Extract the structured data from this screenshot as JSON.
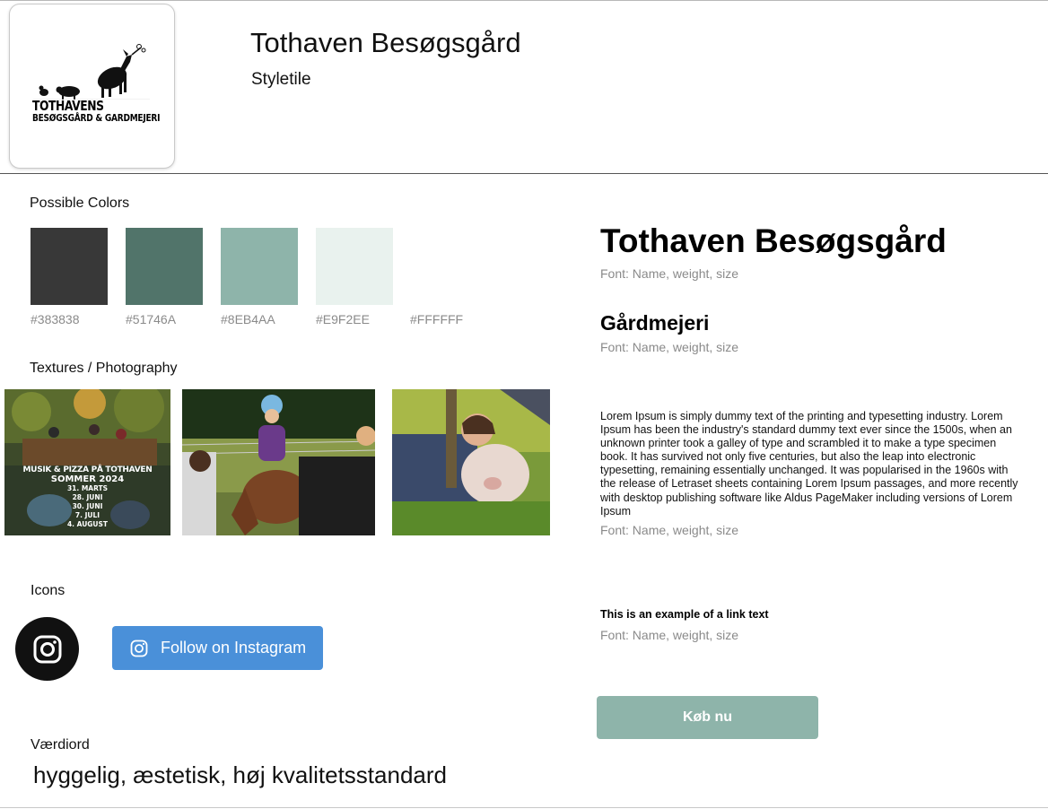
{
  "header": {
    "title": "Tothaven Besøgsgård",
    "subtitle": "Styletile"
  },
  "logo": {
    "line1": "TOTHAVENS",
    "line2": "BESØGSGÅRD & GARDMEJERI"
  },
  "colors": {
    "label": "Possible Colors",
    "swatches": [
      {
        "hex": "#383838",
        "label": "#383838"
      },
      {
        "hex": "#51746A",
        "label": "#51746A"
      },
      {
        "hex": "#8EB4AA",
        "label": "#8EB4AA"
      },
      {
        "hex": "#E9F2EE",
        "label": "#E9F2EE"
      },
      {
        "hex": "#FFFFFF",
        "label": "#FFFFFF"
      }
    ]
  },
  "textures": {
    "label": "Textures / Photography",
    "poster": {
      "title1": "MUSIK & PIZZA PÅ TOTHAVEN",
      "title2": "SOMMER 2024",
      "dates": [
        "31. MARTS",
        "28. JUNI",
        "30. JUNI",
        "7. JULI",
        "4. AUGUST"
      ]
    }
  },
  "icons": {
    "label": "Icons",
    "instagram_circle": "instagram-icon",
    "follow_button": "Follow on Instagram"
  },
  "values": {
    "label": "Værdiord",
    "text": "hyggelig, æstetisk, høj kvalitetsstandard"
  },
  "typography": {
    "h1": "Tothaven Besøgsgård",
    "h2": "Gårdmejeri",
    "body": "Lorem Ipsum is simply dummy text of the printing and typesetting industry. Lorem Ipsum has been the industry's standard dummy text ever since the 1500s, when an unknown printer took a galley of type and scrambled it to make a type specimen book. It has survived not only five centuries, but also the leap into electronic typesetting, remaining essentially unchanged. It was popularised in the 1960s with the release of Letraset sheets containing Lorem Ipsum passages, and more recently with desktop publishing software like Aldus PageMaker including versions of Lorem Ipsum",
    "link": "This is an example of a link text",
    "font_note": "Font: Name, weight, size",
    "buy_button": "Køb nu"
  }
}
